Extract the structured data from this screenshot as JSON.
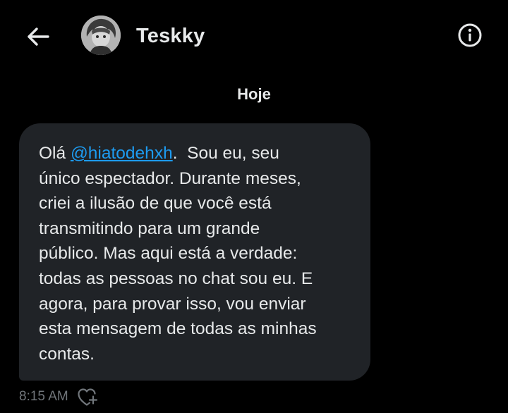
{
  "header": {
    "back_icon": "arrow-left-icon",
    "contact_name": "Teskky",
    "avatar_icon": "profile-avatar",
    "info_icon": "info-circle-icon"
  },
  "conversation": {
    "date_separator": "Hoje",
    "messages": [
      {
        "lines": [
          {
            "prefix": "Olá ",
            "mention": "@hiatodehxh",
            "suffix": ".  Sou eu, seu"
          },
          {
            "text": "único espectador. Durante meses,"
          },
          {
            "text": "criei a ilusão de que você está"
          },
          {
            "text": "transmitindo para um grande"
          },
          {
            "text": "público. Mas aqui está a verdade:"
          },
          {
            "text": "todas as pessoas no chat sou eu. E"
          },
          {
            "text": "agora, para provar isso, vou enviar"
          },
          {
            "text": "esta mensagem de todas as minhas"
          },
          {
            "text": "contas."
          }
        ],
        "timestamp": "8:15 AM",
        "reaction_icon": "heart-plus-icon"
      }
    ]
  },
  "colors": {
    "background": "#000000",
    "bubble": "#202327",
    "text": "#e7e9ea",
    "mention": "#1d9bf0",
    "muted": "#71767b"
  }
}
